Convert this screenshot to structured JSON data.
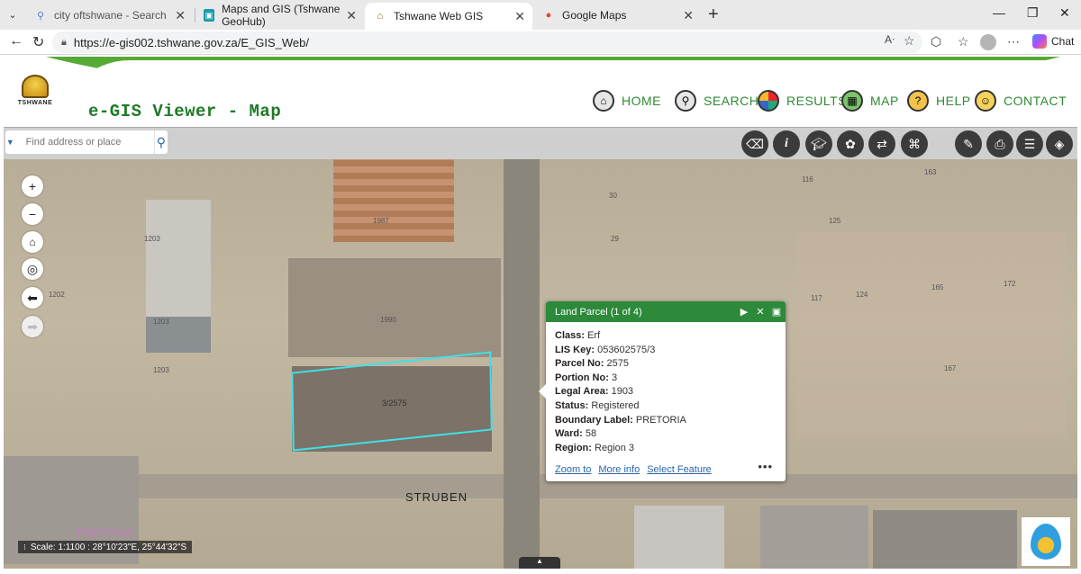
{
  "browser": {
    "tabs": [
      {
        "title": "city oftshwane - Search",
        "icon": "search-icon"
      },
      {
        "title": "Maps and GIS (Tshwane GeoHub)",
        "icon": "geohub-icon"
      },
      {
        "title": "Tshwane Web GIS",
        "icon": "tshwane-icon"
      },
      {
        "title": "Google Maps",
        "icon": "maps-pin-icon"
      }
    ],
    "url": "https://e-gis002.tshwane.gov.za/E_GIS_Web/",
    "chat_label": "Chat"
  },
  "app": {
    "logo_text": "TSHWANE",
    "title": "e-GIS Viewer - Map",
    "menu": [
      {
        "label": "HOME",
        "icon": "home-icon"
      },
      {
        "label": "SEARCH",
        "icon": "magnifier-icon"
      },
      {
        "label": "RESULTS",
        "icon": "results-icon"
      },
      {
        "label": "MAP",
        "icon": "map-icon"
      },
      {
        "label": "HELP",
        "icon": "help-icon"
      },
      {
        "label": "CONTACT",
        "icon": "contact-icon"
      }
    ]
  },
  "toolbar": {
    "search_placeholder": "Find address or place",
    "tools": [
      "eraser-icon",
      "info-icon",
      "graduation-cap-icon",
      "palette-icon",
      "swap-icon",
      "network-icon",
      "measure-icon",
      "print-icon",
      "list-icon",
      "layers-icon"
    ]
  },
  "map": {
    "labels": [
      "1987",
      "1203",
      "1202",
      "1203",
      "1203",
      "1990",
      "29",
      "30",
      "163",
      "116",
      "125",
      "117",
      "124",
      "165",
      "172",
      "167"
    ],
    "parcel_label": "3/2575",
    "street_label": "STRUBEN",
    "city_label": "PRETORIA",
    "scale_text": "Scale: 1:1100 : 28°10'23\"E, 25°44'32\"S"
  },
  "popup": {
    "title": "Land Parcel (1 of 4)",
    "fields": [
      {
        "label": "Class:",
        "value": "Erf"
      },
      {
        "label": "LIS Key:",
        "value": "053602575/3"
      },
      {
        "label": "Parcel No:",
        "value": "2575"
      },
      {
        "label": "Portion No:",
        "value": "3"
      },
      {
        "label": "Legal Area:",
        "value": "1903"
      },
      {
        "label": "Status:",
        "value": "Registered"
      },
      {
        "label": "Boundary Label:",
        "value": "PRETORIA"
      },
      {
        "label": "Ward:",
        "value": "58"
      },
      {
        "label": "Region:",
        "value": "Region 3"
      }
    ],
    "links": [
      "Zoom to",
      "More info",
      "Select Feature"
    ],
    "more": "•••"
  }
}
